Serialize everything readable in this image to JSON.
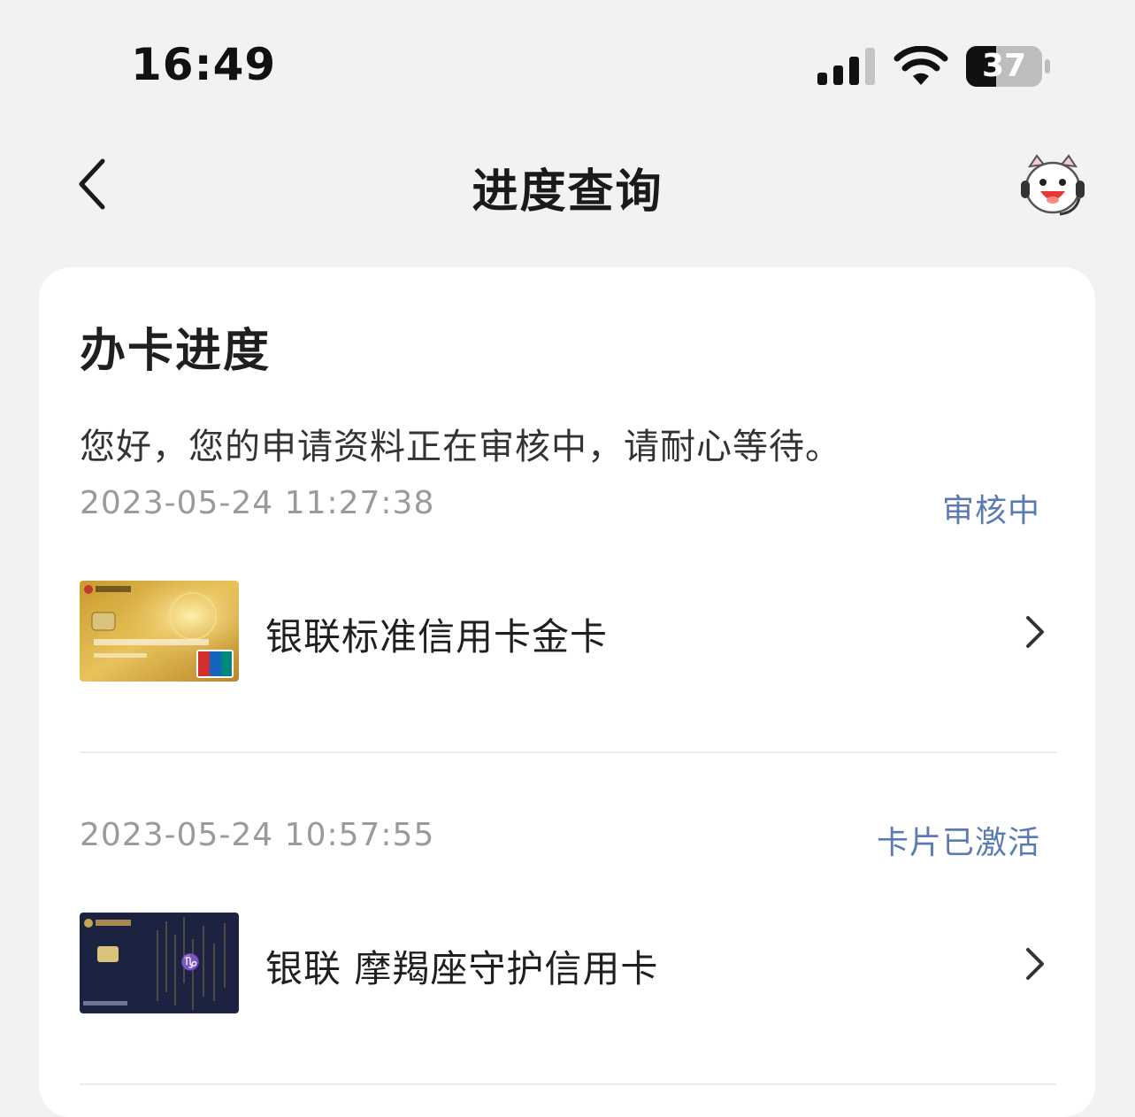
{
  "status_bar": {
    "time": "16:49",
    "battery_level": "37"
  },
  "nav": {
    "title": "进度查询"
  },
  "progress": {
    "title": "办卡进度",
    "message": "您好，您的申请资料正在审核中，请耐心等待。",
    "applications": [
      {
        "timestamp": "2023-05-24 11:27:38",
        "status": "审核中",
        "card_name": "银联标准信用卡金卡"
      },
      {
        "timestamp": "2023-05-24 10:57:55",
        "status": "卡片已激活",
        "card_name": "银联 摩羯座守护信用卡"
      }
    ]
  },
  "colors": {
    "status_blue": "#5b7bb5",
    "background": "#f2f2f2"
  }
}
